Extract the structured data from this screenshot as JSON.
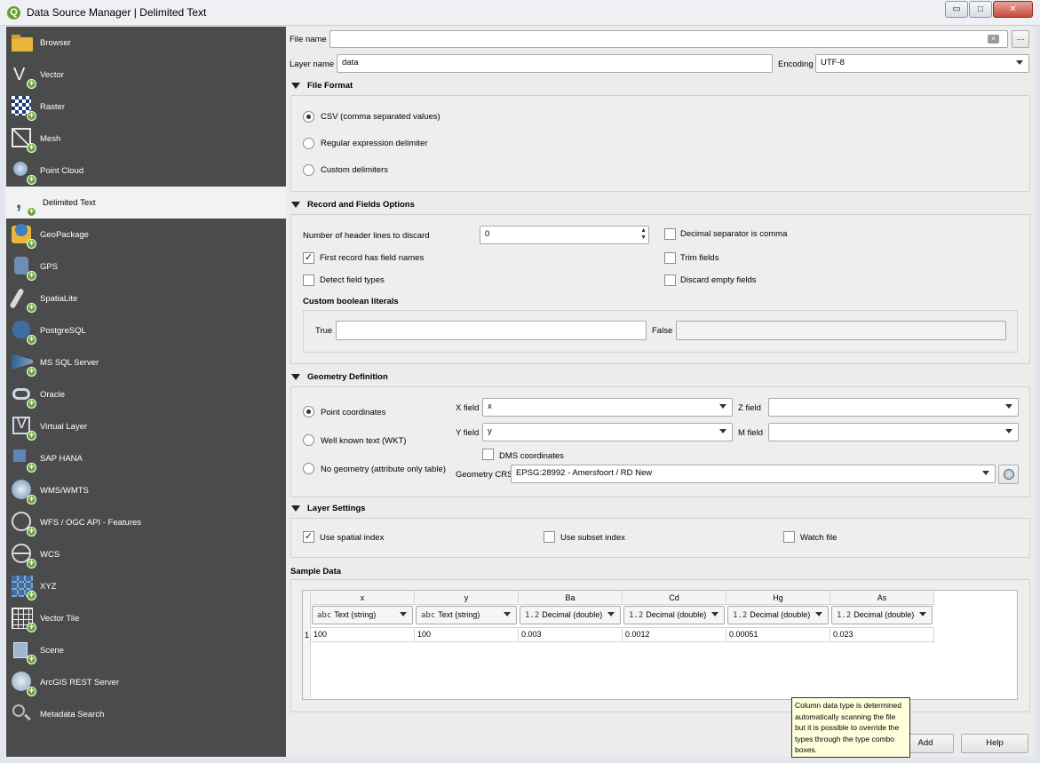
{
  "window": {
    "title": "Data Source Manager | Delimited Text",
    "app_icon": "Q",
    "min": "▭",
    "max": "□",
    "close": "✕"
  },
  "sidebar": {
    "items": [
      {
        "label": "Browser",
        "icon": "folder-icon"
      },
      {
        "label": "Vector",
        "icon": "vector-icon"
      },
      {
        "label": "Raster",
        "icon": "raster-icon"
      },
      {
        "label": "Mesh",
        "icon": "mesh-icon"
      },
      {
        "label": "Point Cloud",
        "icon": "point-cloud-icon"
      },
      {
        "label": "Delimited Text",
        "icon": "delimited-text-icon",
        "active": true
      },
      {
        "label": "GeoPackage",
        "icon": "geopackage-icon"
      },
      {
        "label": "GPS",
        "icon": "gps-icon"
      },
      {
        "label": "SpatiaLite",
        "icon": "spatialite-icon"
      },
      {
        "label": "PostgreSQL",
        "icon": "postgresql-icon"
      },
      {
        "label": "MS SQL Server",
        "icon": "mssql-icon"
      },
      {
        "label": "Oracle",
        "icon": "oracle-icon"
      },
      {
        "label": "Virtual Layer",
        "icon": "virtual-layer-icon"
      },
      {
        "label": "SAP HANA",
        "icon": "sap-hana-icon"
      },
      {
        "label": "WMS/WMTS",
        "icon": "wms-icon"
      },
      {
        "label": "WFS / OGC API - Features",
        "icon": "wfs-icon"
      },
      {
        "label": "WCS",
        "icon": "wcs-icon"
      },
      {
        "label": "XYZ",
        "icon": "xyz-icon"
      },
      {
        "label": "Vector Tile",
        "icon": "vector-tile-icon"
      },
      {
        "label": "Scene",
        "icon": "scene-icon"
      },
      {
        "label": "ArcGIS REST Server",
        "icon": "arcgis-icon"
      },
      {
        "label": "Metadata Search",
        "icon": "metadata-search-icon"
      }
    ]
  },
  "file": {
    "label": "File name",
    "value": "",
    "browse": "…"
  },
  "layer": {
    "label": "Layer name",
    "value": "data",
    "encoding_label": "Encoding",
    "encoding": "UTF-8"
  },
  "file_format": {
    "title": "File Format",
    "options": [
      "CSV (comma separated values)",
      "Regular expression delimiter",
      "Custom delimiters"
    ]
  },
  "records": {
    "title": "Record and Fields Options",
    "header_lines_label": "Number of header lines to discard",
    "header_lines_value": "0",
    "decimal_comma": "Decimal separator is comma",
    "first_record": "First record has field names",
    "trim_fields": "Trim fields",
    "detect_types": "Detect field types",
    "discard_empty": "Discard empty fields",
    "boolean_title": "Custom boolean literals",
    "true_label": "True",
    "false_label": "False",
    "true_value": "",
    "false_value": ""
  },
  "geometry": {
    "title": "Geometry Definition",
    "point": "Point coordinates",
    "wkt": "Well known text (WKT)",
    "none": "No geometry (attribute only table)",
    "x_label": "X field",
    "x_value": "x",
    "y_label": "Y field",
    "y_value": "y",
    "z_label": "Z field",
    "z_value": "",
    "m_label": "M field",
    "m_value": "",
    "dms": "DMS coordinates",
    "crs_label": "Geometry CRS",
    "crs_value": "EPSG:28992 - Amersfoort / RD New"
  },
  "layer_settings": {
    "title": "Layer Settings",
    "spatial_index": "Use spatial index",
    "subset_index": "Use subset index",
    "watch_file": "Watch file"
  },
  "sample": {
    "title": "Sample Data",
    "columns": [
      "x",
      "y",
      "Ba",
      "Cd",
      "Hg",
      "As"
    ],
    "type_prefix": [
      "abc",
      "abc",
      "1.2",
      "1.2",
      "1.2",
      "1.2"
    ],
    "types": [
      "Text (string)",
      "Text (string)",
      "Decimal (double)",
      "Decimal (double)",
      "Decimal (double)",
      "Decimal (double)"
    ],
    "row_number": "1",
    "row": [
      "100",
      "100",
      "0.003",
      "0.0012",
      "0.00051",
      "0.023"
    ]
  },
  "tooltip": "Column data type is determined automatically scanning the file but it is possible to override the types through the type combo boxes.",
  "buttons": {
    "add": "Add",
    "help": "Help"
  }
}
